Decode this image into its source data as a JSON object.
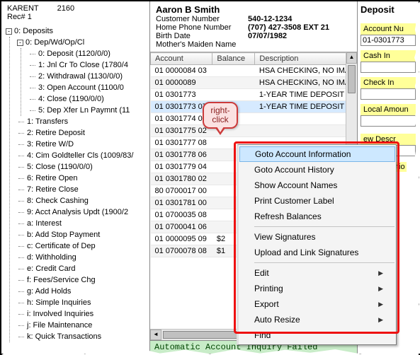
{
  "top": {
    "teller": "KARENT",
    "station": "2160",
    "rec": "Rec#  1"
  },
  "tree": {
    "root": "0: Deposits",
    "group0": {
      "label": "0: Dep/Wd/Op/Cl",
      "items": [
        "0: Deposit (1120/0/0)",
        "1: Jnl Cr To Close (1780/4",
        "2: Withdrawal (1130/0/0)",
        "3: Open Account (1100/0",
        "4: Close (1190/0/0)",
        "5: Dep Xfer Ln Paymnt (11"
      ]
    },
    "items": [
      "1: Transfers",
      "2: Retire Deposit",
      "3: Retire W/D",
      "4: Cim Goldteller Cls (1009/83/",
      "5: Close (1190/0/0)",
      "6: Retire Open",
      "7: Retire Close",
      "8: Check Cashing",
      "9: Acct Analysis Updt (1900/2",
      "a: Interest",
      "b: Add Stop Payment",
      "c: Certificate of Dep",
      "d: Withholding",
      "e: Credit Card",
      "f: Fees/Service Chg",
      "g: Add Holds",
      "h: Simple Inquiries",
      "i: Involved Inquiries",
      "j: File Maintenance",
      "k: Quick Transactions"
    ]
  },
  "customer": {
    "name": "Aaron B Smith",
    "labels": {
      "custno": "Customer Number",
      "phone": "Home Phone Number",
      "birth": "Birth Date",
      "maiden": "Mother's Maiden Name"
    },
    "values": {
      "custno": "540-12-1234",
      "phone": "(707) 427-3508 EXT 21",
      "birth": "07/07/1982",
      "maiden": ""
    }
  },
  "accounts": {
    "headers": {
      "acct": "Account",
      "bal": "Balance",
      "desc": "Description"
    },
    "rows": [
      {
        "acct": "01 0000084 03",
        "bal": "",
        "desc": "HSA CHECKING, NO IMA"
      },
      {
        "acct": "01 0000089",
        "bal": "",
        "desc": "HSA CHECKING, NO IMA"
      },
      {
        "acct": "01 0301773",
        "bal": "",
        "desc": "1-YEAR TIME DEPOSIT"
      },
      {
        "acct": "01 0301773 07",
        "bal": "",
        "desc": "1-YEAR TIME DEPOSIT",
        "selected": true
      },
      {
        "acct": "01 0301774 05",
        "bal": "",
        "desc": ""
      },
      {
        "acct": "01 0301775 02",
        "bal": "",
        "desc": ""
      },
      {
        "acct": "01 0301777 08",
        "bal": "",
        "desc": ""
      },
      {
        "acct": "01 0301778 06",
        "bal": "",
        "desc": ""
      },
      {
        "acct": "01 0301779 04",
        "bal": "",
        "desc": ""
      },
      {
        "acct": "01 0301780 02",
        "bal": "",
        "desc": ""
      },
      {
        "acct": "80 0700017 00",
        "bal": "",
        "desc": ""
      },
      {
        "acct": "01 0301781 00",
        "bal": "",
        "desc": ""
      },
      {
        "acct": "01 0700035 08",
        "bal": "",
        "desc": ""
      },
      {
        "acct": "01 0700041 06",
        "bal": "",
        "desc": ""
      },
      {
        "acct": "01 0000095 09",
        "bal": "$2",
        "desc": ""
      },
      {
        "acct": "01 0700078 08",
        "bal": "$1",
        "desc": ""
      }
    ]
  },
  "context_menu": {
    "items": [
      {
        "label": "Goto Account Information",
        "highlight": true
      },
      {
        "label": "Goto Account History"
      },
      {
        "label": "Show Account Names"
      },
      {
        "label": "Print Customer Label"
      },
      {
        "label": "Refresh Balances"
      },
      {
        "sep": true
      },
      {
        "label": "View Signatures"
      },
      {
        "label": "Upload and Link Signatures"
      },
      {
        "sep": true
      },
      {
        "label": "Edit",
        "submenu": true
      },
      {
        "label": "Printing",
        "submenu": true
      },
      {
        "label": "Export",
        "submenu": true
      },
      {
        "label": "Auto Resize",
        "submenu": true
      },
      {
        "label": "Find"
      }
    ]
  },
  "callout": {
    "text1": "right-",
    "text2": "click"
  },
  "right": {
    "title": "Deposit",
    "labels": {
      "acctno": "Account Nu",
      "cashin": "Cash In",
      "checkin": "Check In",
      "localamt": "Local Amoun",
      "newdesc": "ew Descr",
      "correction": "Correctio"
    },
    "values": {
      "acctno": "01-0301773"
    }
  },
  "status": "Automatic Account Inquiry Failed"
}
